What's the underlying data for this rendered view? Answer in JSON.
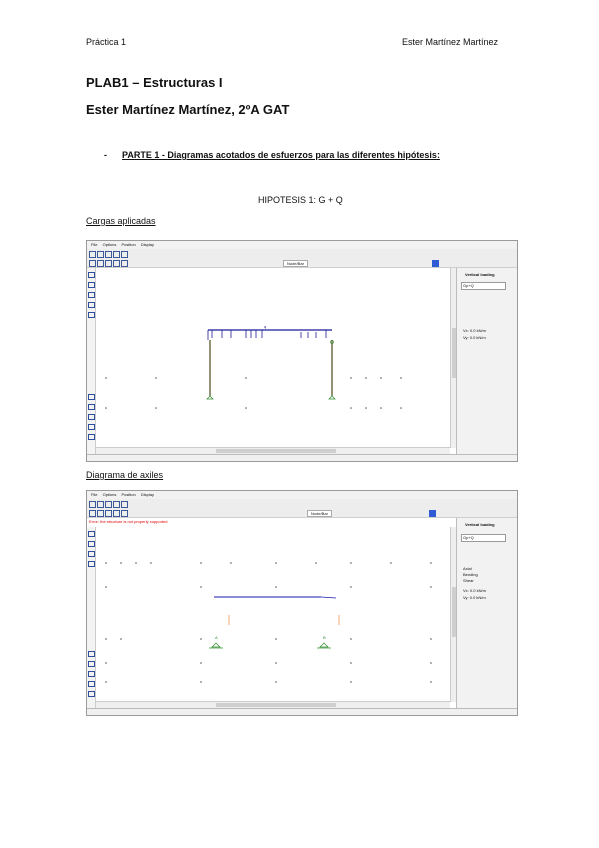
{
  "header": {
    "left": "Práctica 1",
    "right": "Ester Martínez Martínez"
  },
  "doc": {
    "title_line1": "PLAB1 – Estructuras I",
    "title_line2": "Ester Martínez Martínez, 2ºA GAT",
    "bullet": "-",
    "part1": "PARTE 1 - Diagramas acotados de esfuerzos para las diferentes hipótesis:",
    "hypothesis": "HIPOTESIS 1: G + Q",
    "section1": "Cargas aplicadas",
    "section2": "Diagrama de axiles"
  },
  "window1": {
    "menu": [
      "File",
      "Options",
      "Position",
      "Display"
    ],
    "toolbar_field": "Node/Bar",
    "panel_title": "Vertical loading",
    "panel_combo": "Gp+Q",
    "panel_rows": [
      "Vx: 0.0 kN/m",
      "Vy: 0.0 kN/m"
    ],
    "load_label": "q"
  },
  "window2": {
    "menu": [
      "File",
      "Options",
      "Position",
      "Display"
    ],
    "toolbar_field": "Node/Bar",
    "panel_title": "Vertical loading",
    "panel_combo": "Gp+Q",
    "panel_rows": [
      "Axial",
      "Bending",
      "Shear",
      "Vx: 0.0 kN/m",
      "Vy: 0.0 kN/m"
    ],
    "warning": "Error: the structure is not properly supported",
    "supports": [
      "A",
      "B"
    ]
  }
}
